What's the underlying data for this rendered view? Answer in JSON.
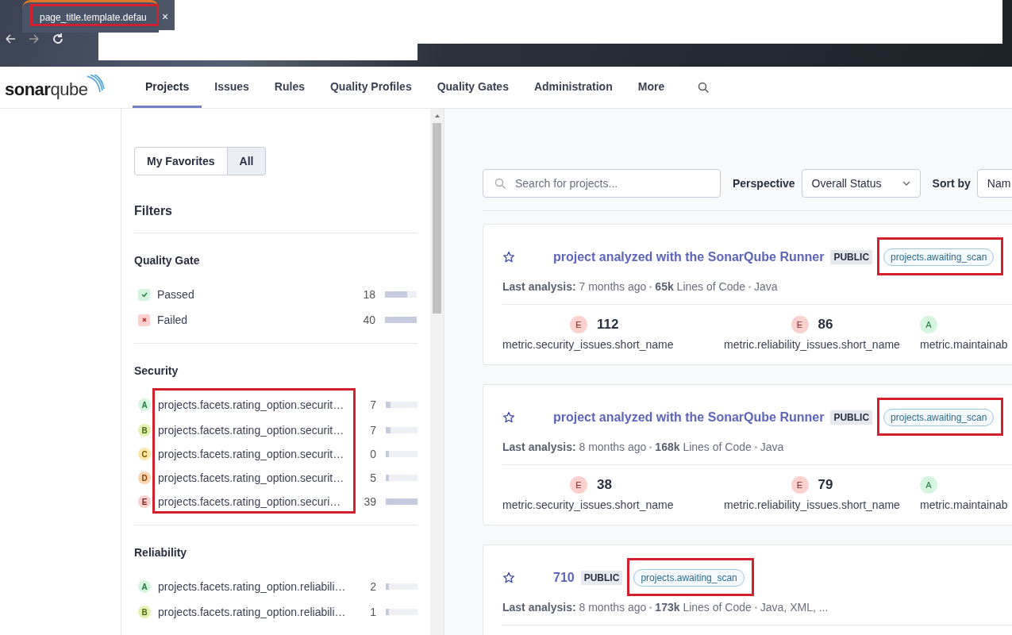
{
  "browser": {
    "tab_title": "page_title.template.defau",
    "tab_highlighted": true,
    "close": "×"
  },
  "nav": {
    "logo_left": "sonar",
    "logo_right": "qube",
    "items": [
      {
        "label": "Projects",
        "selected": true
      },
      {
        "label": "Issues",
        "selected": false
      },
      {
        "label": "Rules",
        "selected": false
      },
      {
        "label": "Quality Profiles",
        "selected": false
      },
      {
        "label": "Quality Gates",
        "selected": false
      },
      {
        "label": "Administration",
        "selected": false
      },
      {
        "label": "More",
        "selected": false
      }
    ]
  },
  "sidebar": {
    "toggle": [
      {
        "label": "My Favorites",
        "selected": false
      },
      {
        "label": "All",
        "selected": true
      }
    ],
    "filters_title": "Filters",
    "facets": [
      {
        "title": "Quality Gate",
        "highlighted": false,
        "options": [
          {
            "kind": "passed",
            "label": "Passed",
            "count": "18",
            "level": 0.7
          },
          {
            "kind": "failed",
            "label": "Failed",
            "count": "40",
            "level": 1
          }
        ]
      },
      {
        "title": "Security",
        "highlighted": true,
        "options": [
          {
            "kind": "rating",
            "rating": "A",
            "label": "projects.facets.rating_option.securit…",
            "count": "7",
            "level": 0.15
          },
          {
            "kind": "rating",
            "rating": "B",
            "label": "projects.facets.rating_option.securit…",
            "count": "7",
            "level": 0.15
          },
          {
            "kind": "rating",
            "rating": "C",
            "label": "projects.facets.rating_option.securit…",
            "count": "0",
            "level": 0.1
          },
          {
            "kind": "rating",
            "rating": "D",
            "label": "projects.facets.rating_option.securit…",
            "count": "5",
            "level": 0.1
          },
          {
            "kind": "rating",
            "rating": "E",
            "label": "projects.facets.rating_option.securi…",
            "count": "39",
            "level": 1
          }
        ]
      },
      {
        "title": "Reliability",
        "highlighted": false,
        "options": [
          {
            "kind": "rating",
            "rating": "A",
            "label": "projects.facets.rating_option.reliabili…",
            "count": "2",
            "level": 0.1
          },
          {
            "kind": "rating",
            "rating": "B",
            "label": "projects.facets.rating_option.reliabili…",
            "count": "1",
            "level": 0.1
          }
        ]
      }
    ]
  },
  "toolbar": {
    "search_placeholder": "Search for projects...",
    "perspective_label": "Perspective",
    "perspective_value": "Overall Status",
    "sort_label": "Sort by",
    "sort_value": "Nam"
  },
  "projects": [
    {
      "name": "project analyzed with the SonarQube Runner",
      "visibility": "PUBLIC",
      "badge": "projects.awaiting_scan",
      "badge_highlighted": true,
      "last_label": "Last analysis:",
      "last_value": "7 months ago",
      "loc": "65k",
      "loc_label": "Lines of Code",
      "languages": "Java",
      "metrics": [
        {
          "rating": "E",
          "value": "112",
          "label": "metric.security_issues.short_name"
        },
        {
          "rating": "E",
          "value": "86",
          "label": "metric.reliability_issues.short_name"
        },
        {
          "rating": "A",
          "label": "metric.maintainab"
        }
      ]
    },
    {
      "name": "project analyzed with the SonarQube Runner",
      "visibility": "PUBLIC",
      "badge": "projects.awaiting_scan",
      "badge_highlighted": true,
      "last_label": "Last analysis:",
      "last_value": "8 months ago",
      "loc": "168k",
      "loc_label": "Lines of Code",
      "languages": "Java",
      "metrics": [
        {
          "rating": "E",
          "value": "38",
          "label": "metric.security_issues.short_name"
        },
        {
          "rating": "E",
          "value": "79",
          "label": "metric.reliability_issues.short_name"
        },
        {
          "rating": "A",
          "label": "metric.maintainab"
        }
      ]
    },
    {
      "name": "710",
      "visibility": "PUBLIC",
      "badge": "projects.awaiting_scan",
      "badge_highlighted": true,
      "last_label": "Last analysis:",
      "last_value": "8 months ago",
      "loc": "173k",
      "loc_label": "Lines of Code",
      "languages": "Java, XML, ..."
    }
  ]
}
